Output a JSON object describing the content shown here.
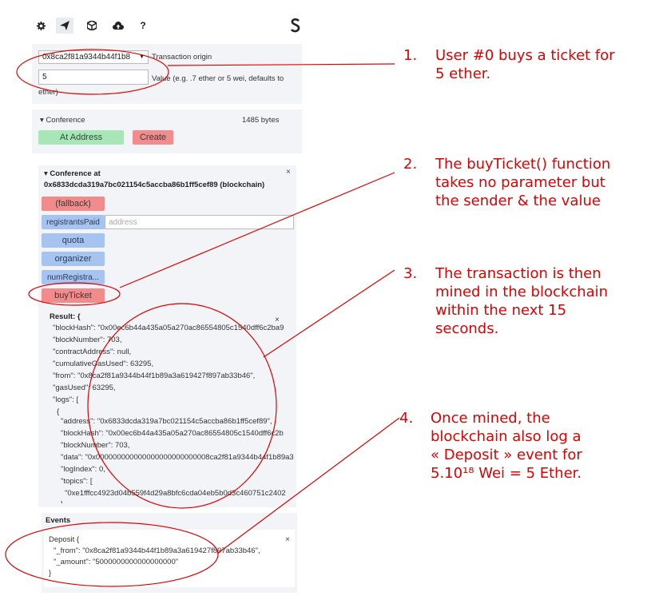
{
  "toolbar": {
    "icons": [
      "gear-icon",
      "send-icon",
      "cube-icon",
      "cloud-upload-icon",
      "help-icon"
    ],
    "help_label": "?",
    "brand_icon": "ethereum-s-icon"
  },
  "origin": {
    "account": "0x8ca2f81a9344b44f1b8",
    "account_label": "Transaction origin",
    "value": "5",
    "value_label_1": "Value (e.g. .7 ether or 5 wei, defaults to",
    "value_label_2": "ether)"
  },
  "contract": {
    "name": "Conference",
    "size": "1485 bytes",
    "at_address_label": "At Address",
    "create_label": "Create"
  },
  "instance": {
    "title_1": "Conference at",
    "title_2": "0x6833dcda319a7bc021154c5accba86b1ff5cef89 (blockchain)",
    "close": "×",
    "functions": {
      "fallback": "(fallback)",
      "registrantsPaid": "registrantsPaid",
      "registrantsPaid_placeholder": "address",
      "quota": "quota",
      "organizer": "organizer",
      "numRegistrants": "numRegistra...",
      "buyTicket": "buyTicket"
    }
  },
  "result": {
    "heading": "Result: {",
    "close": "×",
    "lines": [
      "\"blockHash\": \"0x00ec6b44a435a05a270ac86554805c1540dff6c2ba9",
      "\"blockNumber\": 703,",
      "\"contractAddress\": null,",
      "\"cumulativeGasUsed\": 63295,",
      "\"from\": \"0x8ca2f81a9344b44f1b89a3a619427f897ab33b46\",",
      "\"gasUsed\": 63295,",
      "\"logs\": [",
      "{",
      "\"address\": \"0x6833dcda319a7bc021154c5accba86b1ff5cef89\",",
      "\"blockHash\": \"0x00ec6b44a435a05a270ac86554805c1540dff6c2b",
      "\"blockNumber\": 703,",
      "\"data\": \"0x000000000000000000000000008ca2f81a9344b44f1b89a3",
      "\"logIndex\": 0,",
      "\"topics\": [",
      "\"0xe1fffcc4923d04b559f4d29a8bfc6cda04eb5b0d3c460751c2402",
      "],"
    ]
  },
  "events": {
    "heading": "Events",
    "event_open": "Deposit {",
    "from_line": "\"_from\": \"0x8ca2f81a9344b44f1b89a3a619427f897ab33b46\",",
    "amount_line": "\"_amount\": \"5000000000000000000\"",
    "event_close": "}",
    "close": "×"
  },
  "annotations": [
    {
      "num": "1.",
      "lines": [
        "User #0 buys a ticket for",
        "5 ether."
      ]
    },
    {
      "num": "2.",
      "lines": [
        "The buyTicket() function",
        "takes no parameter but",
        "the sender & the value"
      ]
    },
    {
      "num": "3.",
      "lines": [
        "The transaction is then",
        "mined in the blockchain",
        "within the next 15",
        "seconds."
      ]
    },
    {
      "num": "4.",
      "lines": [
        "Once mined, the",
        "blockchain also log a",
        "« Deposit » event for",
        "5.10¹⁸ Wei = 5 Ether."
      ]
    }
  ],
  "colors": {
    "annotation_red": "#e00000",
    "button_red": "#f28b8b",
    "button_green": "#a8e6b8",
    "button_blue": "#a7c4f0",
    "panel_bg": "#f2f4f8"
  }
}
